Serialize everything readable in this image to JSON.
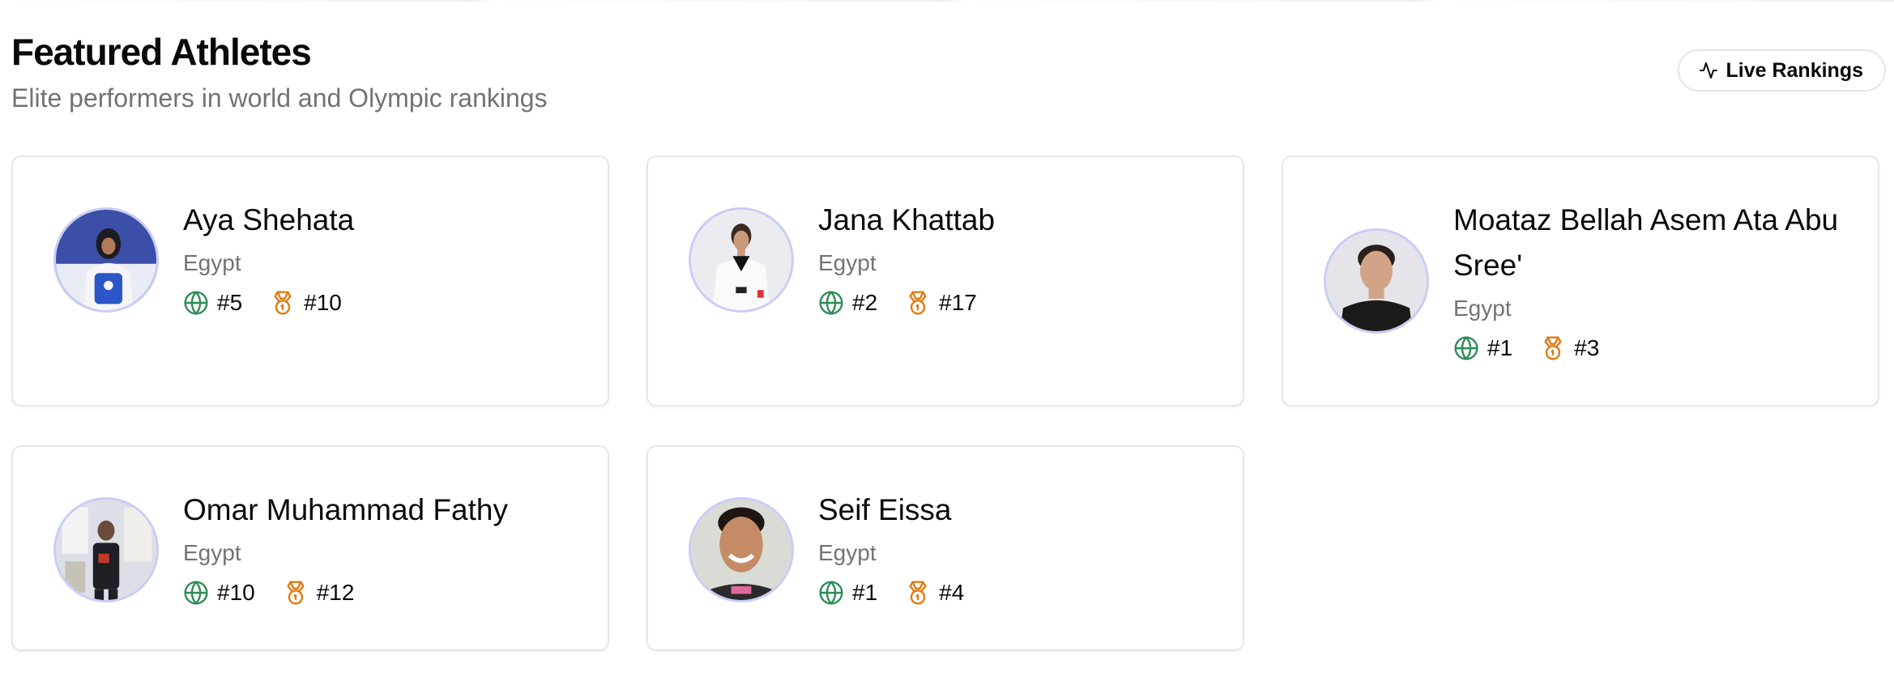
{
  "section": {
    "title": "Featured Athletes",
    "subtitle": "Elite performers in world and Olympic rankings",
    "live_button_label": "Live Rankings"
  },
  "colors": {
    "world_rank_icon": "#2e8b57",
    "olympic_rank_icon": "#e07b14",
    "avatar_ring": "#c9cdf5"
  },
  "icons": {
    "world_rank": "globe-icon",
    "olympic_rank": "medal-icon",
    "live": "activity-icon"
  },
  "athletes": [
    {
      "name": "Aya Shehata",
      "country": "Egypt",
      "world_rank": "#5",
      "olympic_rank": "#10"
    },
    {
      "name": "Jana Khattab",
      "country": "Egypt",
      "world_rank": "#2",
      "olympic_rank": "#17"
    },
    {
      "name": "Moataz Bellah Asem Ata Abu Sree'",
      "country": "Egypt",
      "world_rank": "#1",
      "olympic_rank": "#3"
    },
    {
      "name": "Omar Muhammad Fathy",
      "country": "Egypt",
      "world_rank": "#10",
      "olympic_rank": "#12"
    },
    {
      "name": "Seif Eissa",
      "country": "Egypt",
      "world_rank": "#1",
      "olympic_rank": "#4"
    }
  ]
}
